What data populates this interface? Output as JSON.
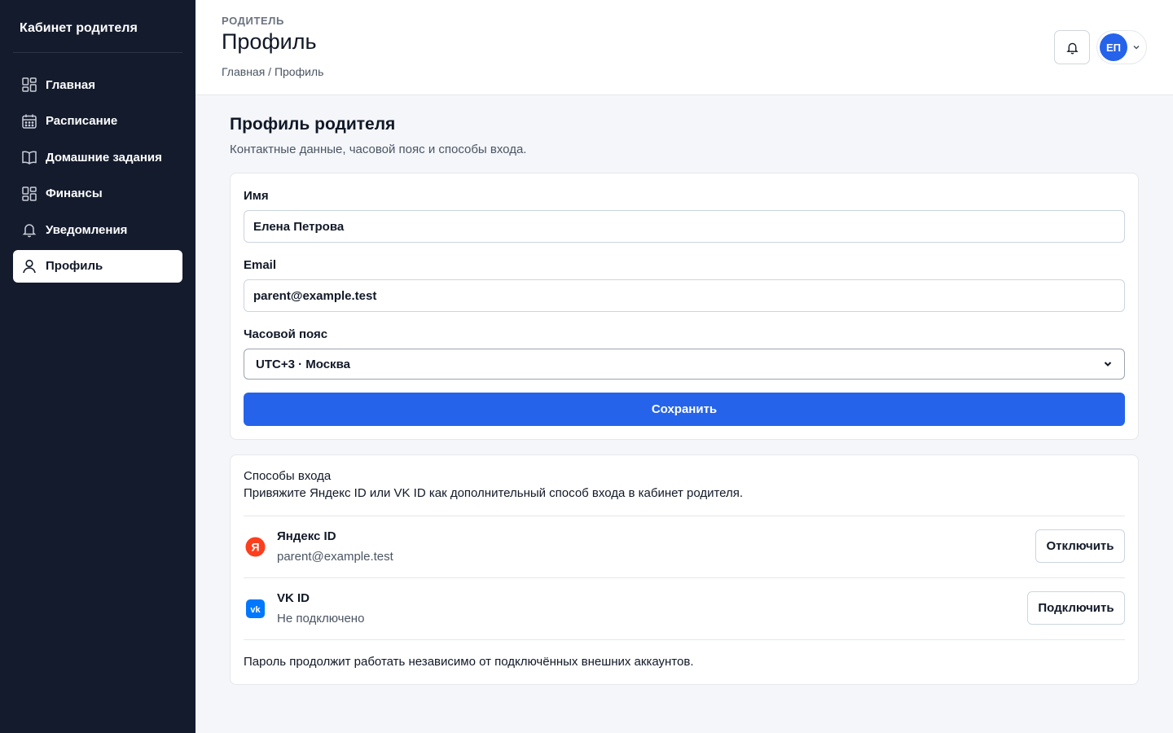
{
  "sidebar": {
    "brand": "Кабинет родителя",
    "items": [
      {
        "label": "Главная",
        "icon": "grid-icon"
      },
      {
        "label": "Расписание",
        "icon": "calendar-icon"
      },
      {
        "label": "Домашние задания",
        "icon": "book-icon"
      },
      {
        "label": "Финансы",
        "icon": "grid-icon"
      },
      {
        "label": "Уведомления",
        "icon": "bell-icon"
      },
      {
        "label": "Профиль",
        "icon": "user-icon",
        "active": true
      }
    ]
  },
  "header": {
    "eyebrow": "РОДИТЕЛЬ",
    "title": "Профиль",
    "breadcrumb": "Главная / Профиль",
    "avatar_initials": "ЕП"
  },
  "main": {
    "section_title": "Профиль родителя",
    "section_subtitle": "Контактные данные, часовой пояс и способы входа.",
    "form": {
      "name_label": "Имя",
      "name_value": "Елена Петрова",
      "email_label": "Email",
      "email_value": "parent@example.test",
      "timezone_label": "Часовой пояс",
      "timezone_value": "UTC+3 · Москва",
      "save_label": "Сохранить"
    },
    "login": {
      "title": "Способы входа",
      "description": "Привяжите Яндекс ID или VK ID как дополнительный способ входа в кабинет родителя.",
      "providers": [
        {
          "name": "Яндекс ID",
          "status": "parent@example.test",
          "action": "Отключить",
          "icon": "yandex-icon"
        },
        {
          "name": "VK ID",
          "status": "Не подключено",
          "action": "Подключить",
          "icon": "vk-icon"
        }
      ],
      "footnote": "Пароль продолжит работать независимо от подключённых внешних аккаунтов."
    }
  },
  "colors": {
    "sidebar_bg": "#141b2d",
    "accent": "#2563eb",
    "page_bg": "#f4f6fa",
    "yandex": "#fc3f1d",
    "vk": "#0077ff"
  }
}
